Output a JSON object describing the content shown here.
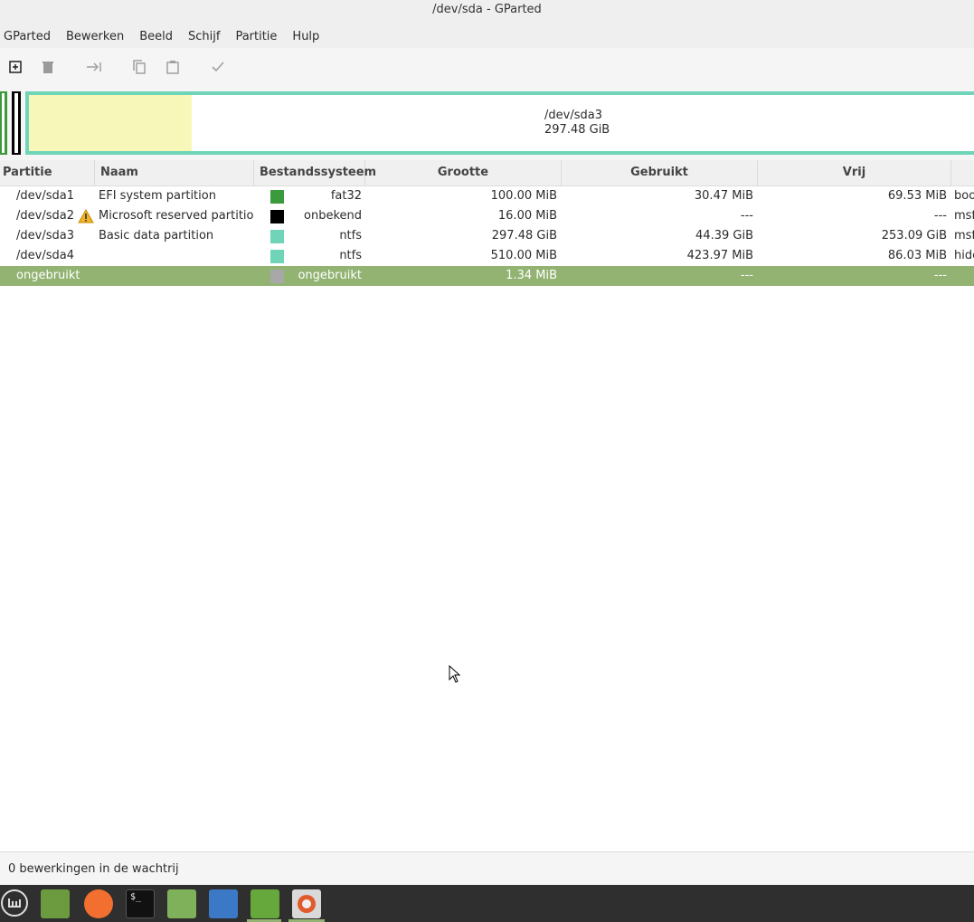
{
  "window": {
    "title": "/dev/sda - GParted"
  },
  "menu": [
    "GParted",
    "Bewerken",
    "Beeld",
    "Schijf",
    "Partitie",
    "Hulp"
  ],
  "toolbar": {
    "icons": [
      "new-partition-icon",
      "delete-icon",
      "resize-move-icon",
      "copy-icon",
      "paste-icon",
      "apply-icon"
    ]
  },
  "diskmap": {
    "selected_label": "/dev/sda3",
    "selected_size": "297.48 GiB",
    "colors": {
      "fat32": "#3b9a3b",
      "unknown": "#000000",
      "ntfs": "#6fd4b8",
      "used": "#f7f7b9"
    }
  },
  "columns": [
    "Partitie",
    "Naam",
    "Bestandssysteem",
    "Grootte",
    "Gebruikt",
    "Vrij"
  ],
  "rows": [
    {
      "partition": "/dev/sda1",
      "name": "EFI system partition",
      "fs": "fat32",
      "fs_color": "#3b9a3b",
      "size": "100.00 MiB",
      "used": "30.47 MiB",
      "free": "69.53 MiB",
      "flags": "boot",
      "warning": false
    },
    {
      "partition": "/dev/sda2",
      "name": "Microsoft reserved partition",
      "fs": "onbekend",
      "fs_color": "#000000",
      "size": "16.00 MiB",
      "used": "---",
      "free": "---",
      "flags": "msf",
      "warning": true
    },
    {
      "partition": "/dev/sda3",
      "name": "Basic data partition",
      "fs": "ntfs",
      "fs_color": "#6fd4b8",
      "size": "297.48 GiB",
      "used": "44.39 GiB",
      "free": "253.09 GiB",
      "flags": "msf",
      "warning": false
    },
    {
      "partition": "/dev/sda4",
      "name": "",
      "fs": "ntfs",
      "fs_color": "#6fd4b8",
      "size": "510.00 MiB",
      "used": "423.97 MiB",
      "free": "86.03 MiB",
      "flags": "hide",
      "warning": false
    },
    {
      "partition": "ongebruikt",
      "name": "",
      "fs": "ongebruikt",
      "fs_color": "#a8a8a8",
      "size": "1.34 MiB",
      "used": "---",
      "free": "---",
      "flags": "",
      "warning": false,
      "selected": true
    }
  ],
  "status": {
    "text": "0 bewerkingen in de wachtrij"
  },
  "taskbar": {
    "icons": [
      "mint-menu-icon",
      "show-desktop-icon",
      "firefox-icon",
      "terminal-icon",
      "files-icon",
      "mail-icon",
      "spreadsheet-icon",
      "gparted-icon"
    ]
  }
}
